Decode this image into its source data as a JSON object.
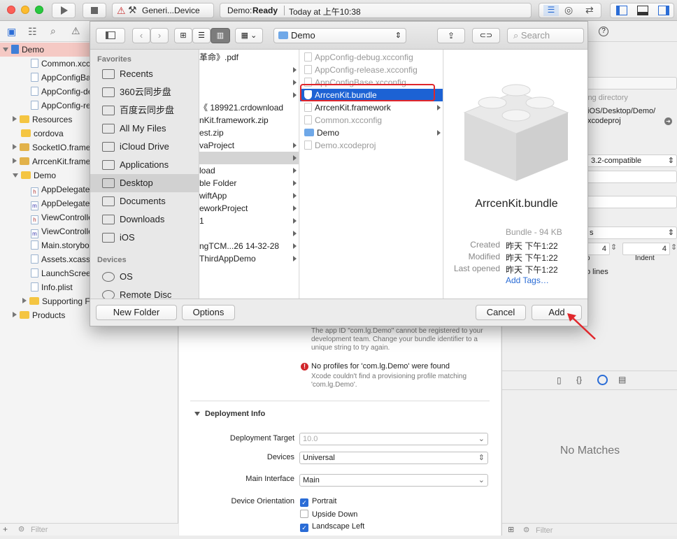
{
  "toolbar": {
    "scheme": "Generi...Device",
    "status_app": "Demo:",
    "status_state": "Ready",
    "status_time": "Today at 上午10:38"
  },
  "navigator": {
    "items": [
      {
        "label": "Demo",
        "kind": "project",
        "indent": 0,
        "disclosure": "open",
        "selected": true
      },
      {
        "label": "Common.xcconfig",
        "kind": "file",
        "indent": 2
      },
      {
        "label": "AppConfigBase.xcconfig",
        "kind": "file",
        "indent": 2
      },
      {
        "label": "AppConfig-debug.xcconfig",
        "kind": "file",
        "indent": 2
      },
      {
        "label": "AppConfig-release.xcconfig",
        "kind": "file",
        "indent": 2
      },
      {
        "label": "Resources",
        "kind": "folder",
        "indent": 1,
        "disclosure": "closed"
      },
      {
        "label": "cordova",
        "kind": "folder",
        "indent": 1
      },
      {
        "label": "SocketIO.framework",
        "kind": "framework",
        "indent": 1,
        "disclosure": "closed"
      },
      {
        "label": "ArrcenKit.framework",
        "kind": "framework",
        "indent": 1,
        "disclosure": "closed"
      },
      {
        "label": "Demo",
        "kind": "folder",
        "indent": 1,
        "disclosure": "open"
      },
      {
        "label": "AppDelegate.h",
        "kind": "h",
        "indent": 2
      },
      {
        "label": "AppDelegate.m",
        "kind": "m",
        "indent": 2
      },
      {
        "label": "ViewController.h",
        "kind": "h",
        "indent": 2
      },
      {
        "label": "ViewController.m",
        "kind": "m",
        "indent": 2
      },
      {
        "label": "Main.storyboard",
        "kind": "file",
        "indent": 2
      },
      {
        "label": "Assets.xcassets",
        "kind": "file",
        "indent": 2
      },
      {
        "label": "LaunchScreen.storyboard",
        "kind": "file",
        "indent": 2
      },
      {
        "label": "Info.plist",
        "kind": "file",
        "indent": 2
      },
      {
        "label": "Supporting Files",
        "kind": "folder",
        "indent": 2,
        "disclosure": "closed"
      },
      {
        "label": "Products",
        "kind": "folder",
        "indent": 1,
        "disclosure": "closed"
      }
    ],
    "filter_placeholder": "Filter"
  },
  "dialog": {
    "location": "Demo",
    "search_placeholder": "Search",
    "favorites_header": "Favorites",
    "devices_header": "Devices",
    "favorites": [
      "Recents",
      "360云同步盘",
      "百度云同步盘",
      "All My Files",
      "iCloud Drive",
      "Applications",
      "Desktop",
      "Documents",
      "Downloads",
      "iOS"
    ],
    "devices": [
      "OS",
      "Remote Disc"
    ],
    "col1": [
      {
        "label": "革命》.pdf",
        "arrow": false
      },
      {
        "label": "",
        "arrow": true
      },
      {
        "label": "",
        "arrow": true
      },
      {
        "label": "",
        "arrow": true
      },
      {
        "label": "《 189921.crdownload",
        "arrow": false
      },
      {
        "label": "nKit.framework.zip",
        "arrow": false
      },
      {
        "label": "est.zip",
        "arrow": false
      },
      {
        "label": "vaProject",
        "arrow": true
      },
      {
        "label": "",
        "arrow": true,
        "highlight": true
      },
      {
        "label": "load",
        "arrow": true
      },
      {
        "label": "ble Folder",
        "arrow": true
      },
      {
        "label": "wiftApp",
        "arrow": true
      },
      {
        "label": "eworkProject",
        "arrow": true
      },
      {
        "label": "1",
        "arrow": true
      },
      {
        "label": "",
        "arrow": true
      },
      {
        "label": "ngTCM...26 14-32-28",
        "arrow": true
      },
      {
        "label": "ThirdAppDemo",
        "arrow": true
      }
    ],
    "col2": [
      {
        "label": "AppConfig-debug.xcconfig",
        "dim": true
      },
      {
        "label": "AppConfig-release.xcconfig",
        "dim": true
      },
      {
        "label": "AppConfigBase.xcconfig",
        "dim": true
      },
      {
        "label": "ArrcenKit.bundle",
        "selected": true
      },
      {
        "label": "ArrcenKit.framework",
        "arrow": true
      },
      {
        "label": "Common.xcconfig",
        "dim": true
      },
      {
        "label": "Demo",
        "arrow": true,
        "folder": true
      },
      {
        "label": "Demo.xcodeproj",
        "dim": true
      }
    ],
    "preview": {
      "name": "ArrcenKit.bundle",
      "kind": "Bundle - 94 KB",
      "created_label": "Created",
      "created": "昨天 下午1:22",
      "modified_label": "Modified",
      "modified": "昨天 下午1:22",
      "opened_label": "Last opened",
      "opened": "昨天 下午1:22",
      "add_tags": "Add Tags…"
    },
    "buttons": {
      "new_folder": "New Folder",
      "options": "Options",
      "cancel": "Cancel",
      "add": "Add"
    }
  },
  "editor": {
    "warning1": "The app ID \"com.lg.Demo\" cannot be registered to your development team. Change your bundle identifier to a unique string to try again.",
    "error_title": "No profiles for 'com.lg.Demo' were found",
    "error_detail": "Xcode couldn't find a provisioning profile matching 'com.lg.Demo'.",
    "section": "Deployment Info",
    "deploy_target_label": "Deployment Target",
    "deploy_target": "10.0",
    "devices_label": "Devices",
    "devices": "Universal",
    "main_interface_label": "Main Interface",
    "main_interface": "Main",
    "orientation_label": "Device Orientation",
    "orient": [
      {
        "label": "Portrait",
        "checked": true
      },
      {
        "label": "Upside Down",
        "checked": false
      },
      {
        "label": "Landscape Left",
        "checked": true
      }
    ]
  },
  "inspector": {
    "frag1": "ute",
    "frag2": "ing directory",
    "path1": "iOS/Desktop/Demo/",
    "path2": "xcodeproj",
    "compat": "3.2-compatible",
    "s": "s",
    "indent_val1": "4",
    "indent_val2": "4",
    "indent_label": "Indent",
    "o": "o",
    "lines": "o lines",
    "no_matches": "No Matches",
    "filter_placeholder": "Filter"
  }
}
